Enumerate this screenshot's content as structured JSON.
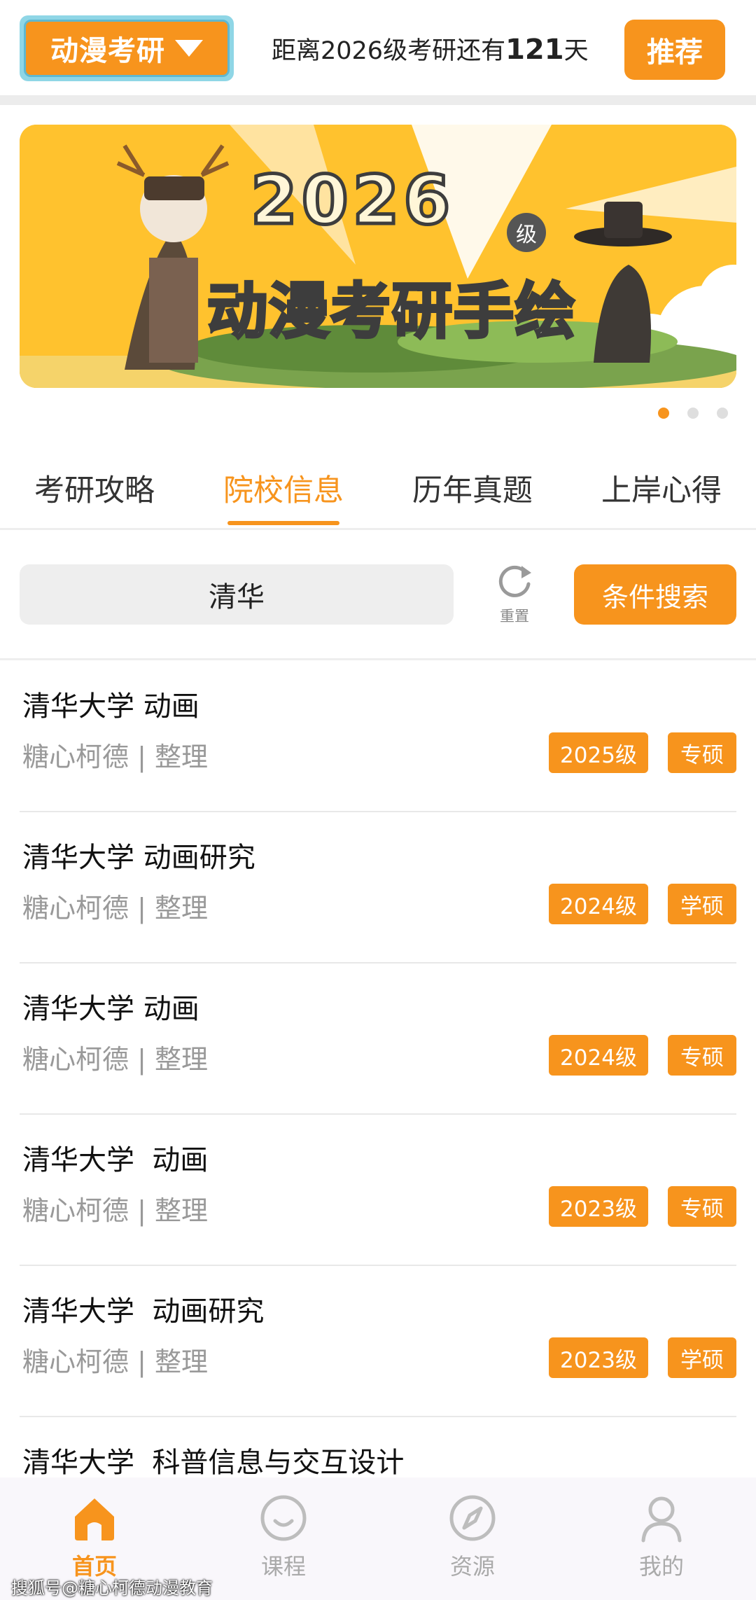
{
  "header": {
    "brand_label": "动漫考研",
    "countdown_prefix": "距离2026级考研还有",
    "countdown_days": "121",
    "countdown_suffix": "天",
    "recommend_label": "推荐"
  },
  "banner": {
    "headline_year": "2026",
    "headline_grade": "级",
    "headline_title": "动漫考研手绘",
    "page_count": 3,
    "active_page": 1
  },
  "tabs": [
    {
      "label": "考研攻略",
      "active": false
    },
    {
      "label": "院校信息",
      "active": true
    },
    {
      "label": "历年真题",
      "active": false
    },
    {
      "label": "上岸心得",
      "active": false
    }
  ],
  "search": {
    "value": "清华",
    "reset_label": "重置",
    "submit_label": "条件搜索"
  },
  "list": [
    {
      "title": "清华大学 动画",
      "meta": "糖心柯德 | 整理",
      "year": "2025级",
      "type": "专硕"
    },
    {
      "title": "清华大学 动画研究",
      "meta": "糖心柯德 | 整理",
      "year": "2024级",
      "type": "学硕"
    },
    {
      "title": "清华大学 动画",
      "meta": "糖心柯德 | 整理",
      "year": "2024级",
      "type": "专硕"
    },
    {
      "title": "清华大学  动画",
      "meta": "糖心柯德 | 整理",
      "year": "2023级",
      "type": "专硕"
    },
    {
      "title": "清华大学  动画研究",
      "meta": "糖心柯德 | 整理",
      "year": "2023级",
      "type": "学硕"
    },
    {
      "title": "清华大学  科普信息与交互设计",
      "meta": "",
      "year": "",
      "type": ""
    }
  ],
  "bottom_nav": [
    {
      "label": "首页",
      "icon": "home-icon",
      "active": true
    },
    {
      "label": "课程",
      "icon": "smile-icon",
      "active": false
    },
    {
      "label": "资源",
      "icon": "compass-icon",
      "active": false
    },
    {
      "label": "我的",
      "icon": "user-icon",
      "active": false
    }
  ],
  "watermark": "搜狐号@糖心柯德动漫教育",
  "colors": {
    "accent": "#f7941d",
    "banner_bg": "#ffc22e",
    "muted_text": "#999999"
  }
}
